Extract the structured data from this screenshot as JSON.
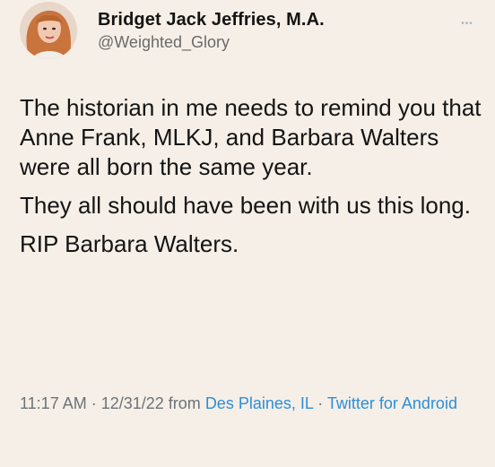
{
  "author": {
    "display_name": "Bridget Jack Jeffries, M.A.",
    "handle": "@Weighted_Glory"
  },
  "tweet": {
    "paragraphs": [
      "The historian in me needs to remind you that Anne Frank, MLKJ, and Barbara Walters were all born the same year.",
      "They all should have been with us this long.",
      "RIP Barbara Walters."
    ]
  },
  "meta": {
    "time": "11:17 AM",
    "sep1": " · ",
    "date": "12/31/22",
    "from_text": " from ",
    "location": "Des Plaines, IL",
    "sep2": " · ",
    "client": "Twitter for Android"
  },
  "colors": {
    "background": "#f6efe7",
    "link": "#2c8fd8",
    "secondary_text": "#6c7277"
  },
  "icons": {
    "more": "more-options-icon",
    "avatar": "profile-avatar"
  }
}
